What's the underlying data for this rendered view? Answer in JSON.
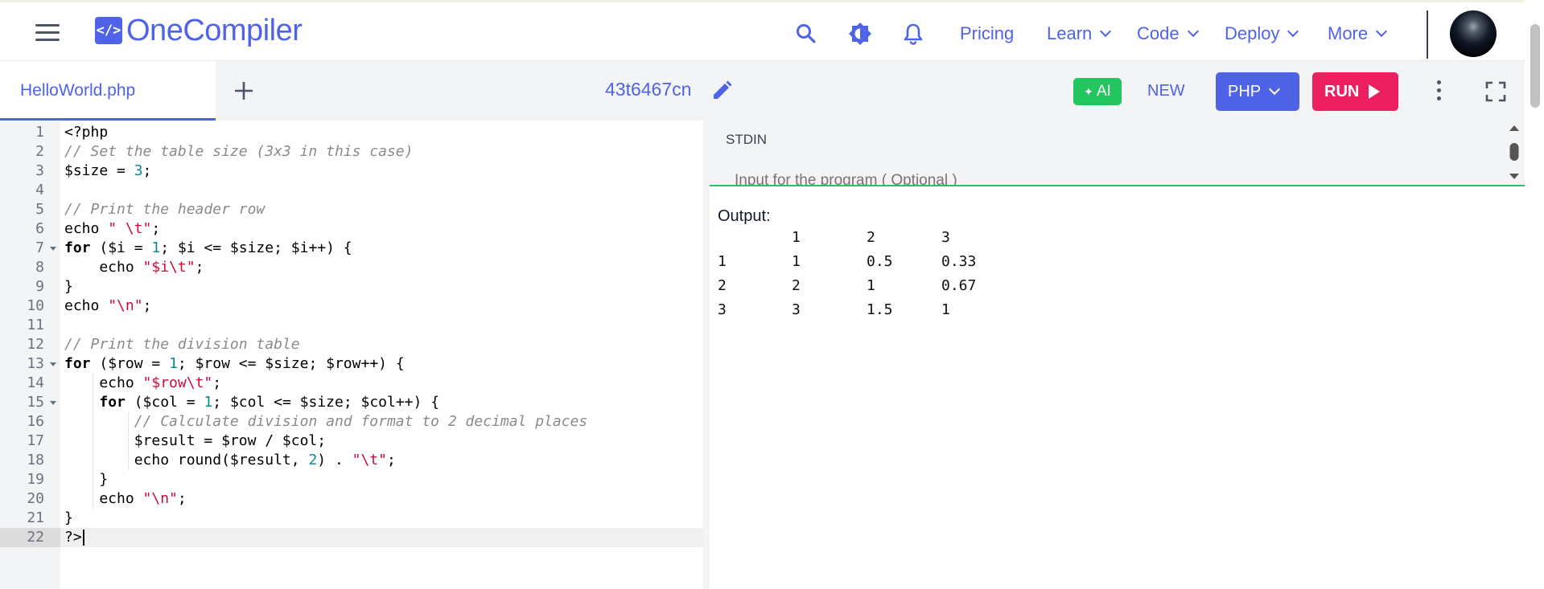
{
  "header": {
    "logo_badge": "</>",
    "logo_text": "OneCompiler",
    "nav": [
      {
        "label": "Pricing",
        "dropdown": false
      },
      {
        "label": "Learn",
        "dropdown": true
      },
      {
        "label": "Code",
        "dropdown": true
      },
      {
        "label": "Deploy",
        "dropdown": true
      },
      {
        "label": "More",
        "dropdown": true
      }
    ]
  },
  "toolbar": {
    "file_tab": "HelloWorld.php",
    "snippet_id": "43t6467cn",
    "ai_label": "AI",
    "new_label": "NEW",
    "language": "PHP",
    "run_label": "RUN"
  },
  "editor": {
    "active_line": 22,
    "lines": [
      "<?php",
      "// Set the table size (3x3 in this case)",
      "$size = 3;",
      "",
      "// Print the header row",
      "echo \" \\t\";",
      "for ($i = 1; $i <= $size; $i++) {",
      "    echo \"$i\\t\";",
      "}",
      "echo \"\\n\";",
      "",
      "// Print the division table",
      "for ($row = 1; $row <= $size; $row++) {",
      "    echo \"$row\\t\";",
      "    for ($col = 1; $col <= $size; $col++) {",
      "        // Calculate division and format to 2 decimal places",
      "        $result = $row / $col;",
      "        echo round($result, 2) . \"\\t\";",
      "    }",
      "    echo \"\\n\";",
      "}",
      "?>"
    ],
    "fold_lines": [
      7,
      13,
      15
    ]
  },
  "stdin": {
    "label": "STDIN",
    "placeholder": "Input for the program ( Optional )"
  },
  "output": {
    "label": "Output:",
    "rows": [
      [
        "",
        "1",
        "2",
        "3"
      ],
      [
        "1",
        "1",
        "0.5",
        "0.33"
      ],
      [
        "2",
        "2",
        "1",
        "0.67"
      ],
      [
        "3",
        "3",
        "1.5",
        "1"
      ]
    ]
  },
  "colors": {
    "brand": "#4f63e7",
    "run": "#ec1f61",
    "ai": "#22c55e"
  }
}
